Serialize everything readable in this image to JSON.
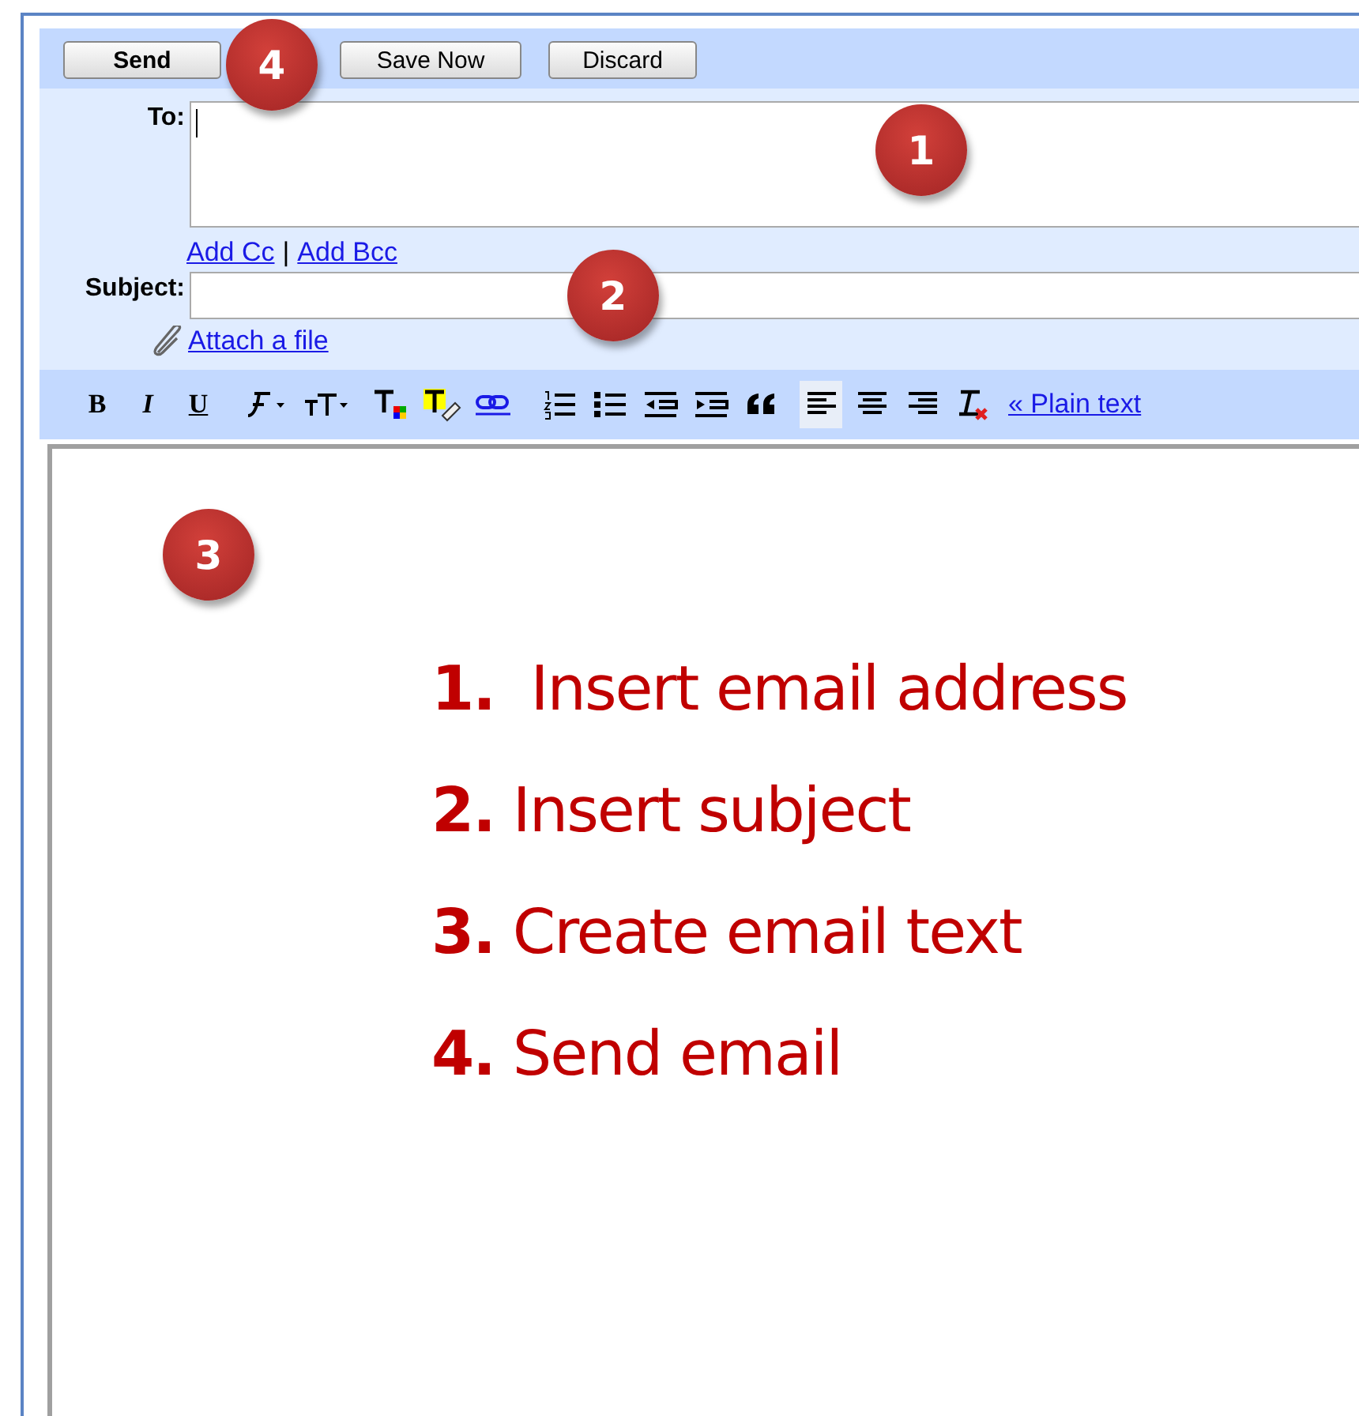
{
  "actions": [
    {
      "label": "Send",
      "kind": "primary",
      "badge": "4"
    },
    {
      "label": "Save Now",
      "kind": "normal"
    },
    {
      "label": "Discard",
      "kind": "normal"
    }
  ],
  "to": {
    "label": "To:",
    "badge": "1"
  },
  "cc_links": [
    {
      "label": "Add Cc"
    },
    {
      "label": "Add Bcc"
    }
  ],
  "cc_separator": "|",
  "subject": {
    "label": "Subject:",
    "badge": "2"
  },
  "attach": {
    "label": "Attach a file"
  },
  "toolbar": [
    {
      "kind": "bold",
      "label": "B"
    },
    {
      "kind": "italic",
      "label": "I"
    },
    {
      "kind": "underline",
      "label": "U"
    },
    {
      "kind": "font"
    },
    {
      "kind": "size"
    },
    {
      "kind": "textcolor"
    },
    {
      "kind": "highlight"
    },
    {
      "kind": "link"
    },
    {
      "kind": "numbered"
    },
    {
      "kind": "bulleted"
    },
    {
      "kind": "outdent"
    },
    {
      "kind": "indent"
    },
    {
      "kind": "quote"
    },
    {
      "kind": "align-left",
      "selected": true
    },
    {
      "kind": "align-center",
      "selected": false
    },
    {
      "kind": "align-right",
      "selected": false
    },
    {
      "kind": "clear"
    }
  ],
  "plain_text_link": "« Plain text",
  "body": {
    "badge": "3",
    "steps": [
      "**1.**  Insert email address",
      "**2.** Insert subject",
      "**3.** Create email text",
      "**4.** Send email"
    ]
  }
}
